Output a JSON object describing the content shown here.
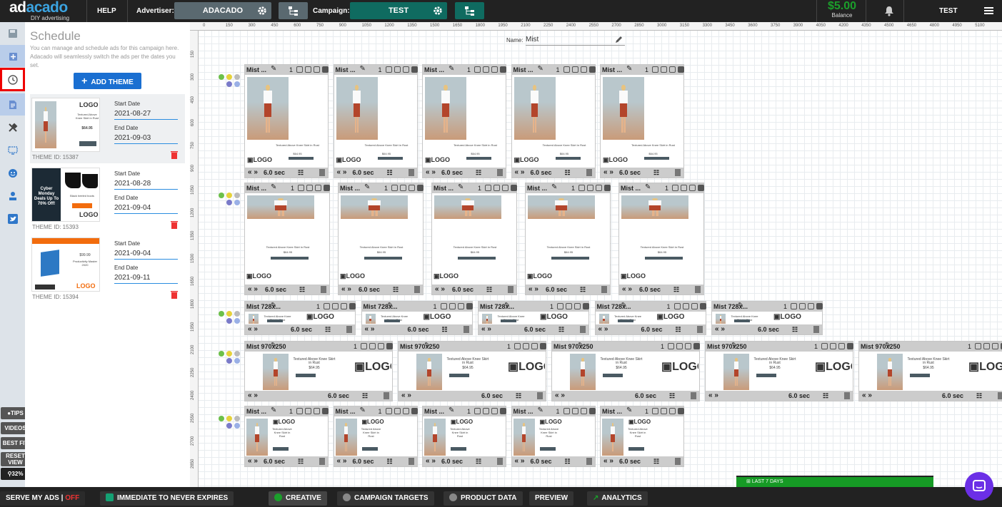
{
  "topbar": {
    "logo_main_a": "ad",
    "logo_main_b": "acado",
    "logo_sub": "DIY advertising",
    "help": "HELP",
    "advertiser_label": "Advertiser:",
    "advertiser_value": "ADACADO",
    "campaign_label": "Campaign:",
    "campaign_value": "TEST",
    "balance_amount": "$5.00",
    "balance_label": "Balance",
    "user": "TEST"
  },
  "sidebar_left": {
    "icons": [
      "save-icon",
      "add-layer-icon",
      "clock-icon",
      "document-edit-icon",
      "tools-icon",
      "monitor-icon",
      "emoji-icon",
      "user-stamp-icon",
      "twitter-icon"
    ],
    "active": "clock-icon",
    "tips": "TIPS",
    "videos": "VIDEOS",
    "best_fit": "BEST FIT",
    "reset_view_1": "RESET",
    "reset_view_2": "VIEW",
    "zoom": "32%"
  },
  "schedule": {
    "title": "Schedule",
    "description": "You can manage and schedule ads for this campaign here. Adacado will seamlessly switch the ads per the dates you set.",
    "add_theme": "ADD THEME",
    "themes": [
      {
        "id_label": "THEME ID: 15387",
        "start_label": "Start Date",
        "start": "2021-08-27",
        "end_label": "End Date",
        "end": "2021-09-03",
        "thumb_text": "Textured Above Knee Skirt in Rust",
        "thumb_price": "$64.95"
      },
      {
        "id_label": "THEME ID: 15393",
        "start_label": "Start Date",
        "start": "2021-08-28",
        "end_label": "End Date",
        "end": "2021-09-04",
        "thumb_text": "Cyber Monday Deals Up To 70% Off!",
        "thumb_price": "Black heeled boots"
      },
      {
        "id_label": "THEME ID: 15394",
        "start_label": "Start Date",
        "start": "2021-09-04",
        "end_label": "End Date",
        "end": "2021-09-11",
        "thumb_text": "Productivity Master 2020",
        "thumb_price": "$99.99"
      }
    ]
  },
  "canvas": {
    "name_label": "Name:",
    "name_value": "Mist",
    "ruler_h": [
      "0",
      "150",
      "300",
      "450",
      "600",
      "750",
      "900",
      "1050",
      "1200",
      "1350",
      "1500",
      "1650",
      "1800",
      "1950",
      "2100",
      "2250",
      "2400",
      "2550",
      "2700",
      "2850",
      "3000",
      "3150",
      "3300",
      "3450",
      "3600",
      "3750",
      "3900",
      "4050",
      "4200",
      "4350",
      "4500",
      "4650",
      "4800",
      "4950",
      "5100"
    ],
    "ruler_v": [
      "150",
      "300",
      "450",
      "600",
      "750",
      "900",
      "1050",
      "1200",
      "1350",
      "1500",
      "1650",
      "1800",
      "1950",
      "2100",
      "2250",
      "2400",
      "2550",
      "2700",
      "2850"
    ],
    "tile_title": "Mist ...",
    "tile_title_728": "Mist 728x...",
    "tile_title_970": "Mist 970x250",
    "tile_count": "1",
    "tile_duration": "6.0 sec",
    "logo_text": "LOGO",
    "product_text": "Textured Above Knee Skirt in Rust",
    "product_price": "$64.95",
    "order_btn": "order now"
  },
  "bottombar": {
    "serve": "SERVE MY ADS |",
    "serve_state": "OFF",
    "immediate": "IMMEDIATE TO NEVER EXPIRES",
    "creative": "CREATIVE",
    "targets": "CAMPAIGN TARGETS",
    "product": "PRODUCT DATA",
    "preview": "PREVIEW",
    "analytics": "ANALYTICS",
    "last7": "LAST 7 DAYS"
  },
  "colors": {
    "accent_blue": "#1a6fd1",
    "campaign_teal": "#0f6b60",
    "balance_green": "#1b9f2b",
    "highlight_red": "#e00000",
    "chat_purple": "#6b2fe6"
  }
}
